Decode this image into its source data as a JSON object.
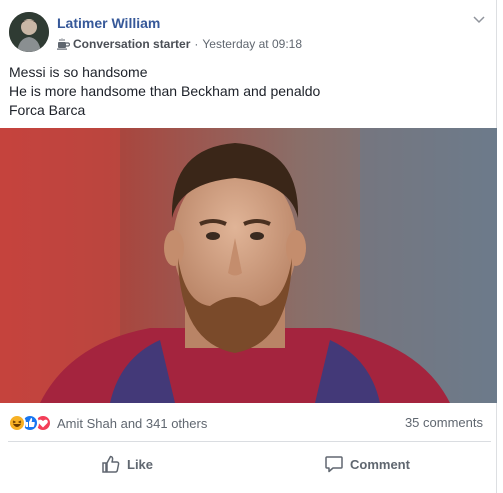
{
  "post": {
    "author": "Latimer William",
    "badge": "Conversation starter",
    "separator": "·",
    "timestamp": "Yesterday at 09:18",
    "text_lines": [
      "Messi is so handsome",
      "He is more handsome than Beckham and penaldo",
      "Forca Barca"
    ]
  },
  "reactions": {
    "icons": [
      "haha-icon",
      "like-icon",
      "love-icon"
    ],
    "summary": "Amit Shah and 341 others",
    "comments": "35 comments"
  },
  "actions": {
    "like_label": "Like",
    "comment_label": "Comment"
  },
  "colors": {
    "author": "#365899",
    "like_blue": "#1877f2",
    "love_red": "#f33e58",
    "haha_yellow": "#f7b125"
  }
}
